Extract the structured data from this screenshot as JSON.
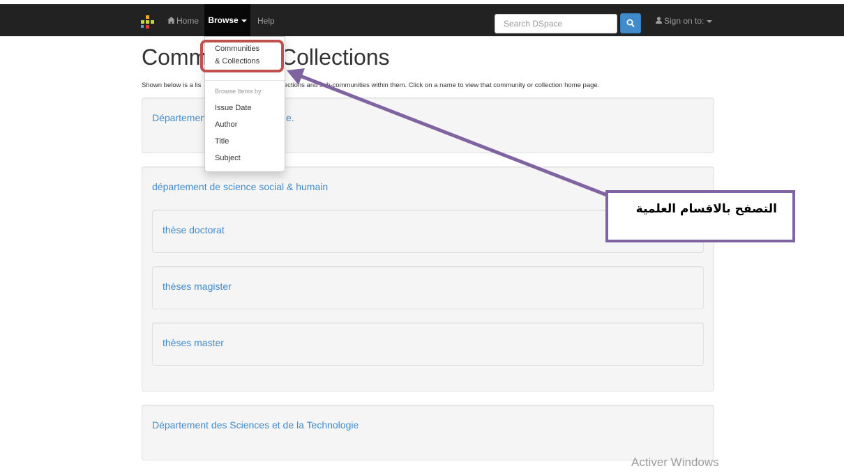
{
  "navbar": {
    "home_label": "Home",
    "browse_label": "Browse",
    "help_label": "Help",
    "search_placeholder": "Search DSpace",
    "signon_label": "Sign on to:"
  },
  "browse_menu": {
    "communities_line1": "Communities",
    "communities_line2": "& Collections",
    "header": "Browse Items by:",
    "items": [
      "Issue Date",
      "Author",
      "Title",
      "Subject"
    ]
  },
  "page": {
    "title_start": "Commu",
    "title_end": "Collections",
    "intro_start": "Shown below is a lis",
    "intro_end": "collections and sub-communities within them. Click on a name to view that community or collection home page."
  },
  "communities": [
    {
      "name": "Département",
      "name_tail": "e."
    },
    {
      "name": "département de science social & humain",
      "collections": [
        "thèse doctorat",
        "thèses magister",
        "thèses master"
      ]
    },
    {
      "name": "Département des Sciences et de la Technologie"
    }
  ],
  "annotation": {
    "callout_text": "التصفح بالاقسام العلمية",
    "box_color": "#c0504d",
    "arrow_color": "#8064a2"
  },
  "watermark": "Activer Windows",
  "colors": {
    "navbar": "#222222",
    "link": "#428bca",
    "search_button": "#428bca"
  }
}
